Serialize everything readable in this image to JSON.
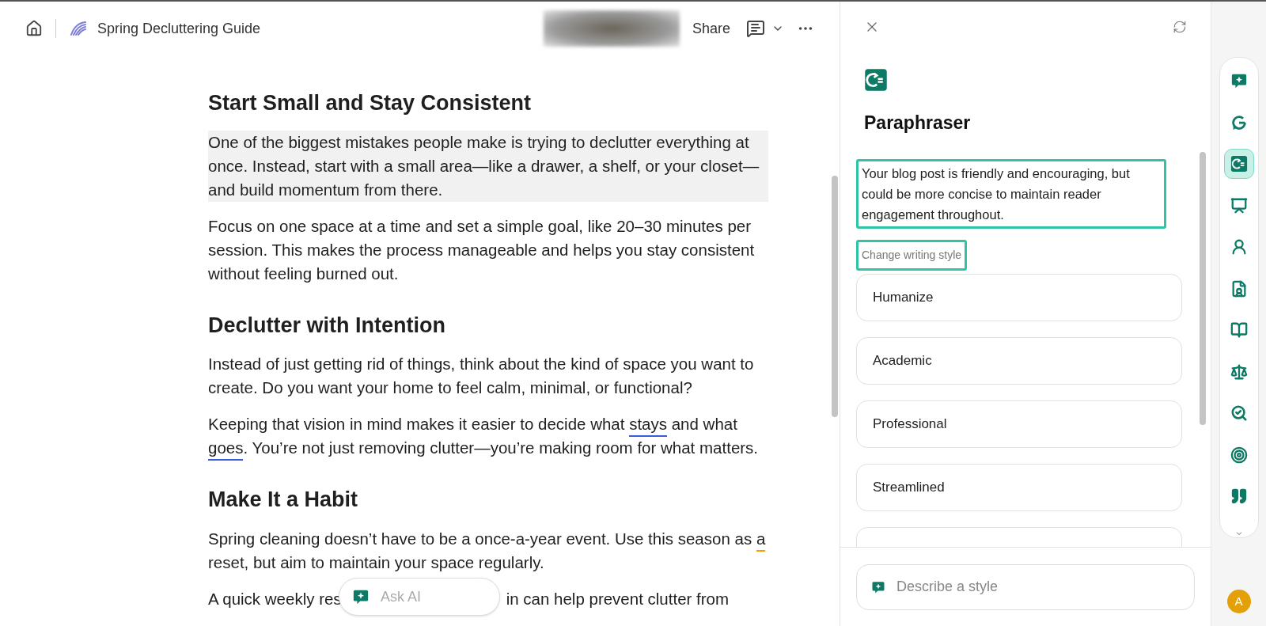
{
  "header": {
    "title": "Spring Decluttering Guide",
    "share": "Share"
  },
  "document": {
    "sections": [
      {
        "heading": "Start Small and Stay Consistent",
        "paragraphs": [
          {
            "highlighted": true,
            "segments": [
              {
                "text": "One of the biggest mistakes people make is trying to declutter everything at once. Instead, start with a small area—like a drawer, a shelf, or your closet—and build momentum from there."
              }
            ]
          },
          {
            "highlighted": false,
            "segments": [
              {
                "text": "Focus on one space at a time and set a simple goal, like 20–30 minutes per session. This makes the process manageable and helps you stay consistent without feeling burned out."
              }
            ]
          }
        ]
      },
      {
        "heading": "Declutter with Intention",
        "paragraphs": [
          {
            "highlighted": false,
            "segments": [
              {
                "text": "Instead of just getting rid of things, think about the kind of space you want to create. Do you want your home to feel calm, minimal, or functional?"
              }
            ]
          },
          {
            "highlighted": false,
            "segments": [
              {
                "text": "Keeping that vision in mind makes it easier to decide what "
              },
              {
                "text": "stays",
                "color": "#3b5bdb"
              },
              {
                "text": " and what "
              },
              {
                "text": "goes",
                "color": "#3b5bdb"
              },
              {
                "text": ". You’re not just removing clutter—you’re making room for what matters."
              }
            ]
          }
        ]
      },
      {
        "heading": "Make It a Habit",
        "paragraphs": [
          {
            "highlighted": false,
            "segments": [
              {
                "text": "Spring cleaning doesn’t have to be a once-a-year event. Use this season as "
              },
              {
                "text": "a",
                "color": "#f59f00"
              },
              {
                "text": " reset, but aim to maintain your space regularly."
              }
            ]
          }
        ]
      }
    ],
    "partial_line": {
      "before": "A quick weekly res",
      "after": "in can help prevent clutter from"
    },
    "ask_ai": {
      "placeholder": "Ask AI"
    }
  },
  "panel": {
    "title": "Paraphraser",
    "summary": "Your blog post is friendly and encouraging, but could be more concise to maintain reader engagement throughout.",
    "section_label": "Change writing style",
    "styles": [
      "Humanize",
      "Academic",
      "Professional",
      "Streamlined"
    ],
    "input": {
      "placeholder": "Describe a style"
    }
  },
  "tools": [
    {
      "selected": false
    },
    {
      "selected": false
    },
    {
      "selected": true
    },
    {
      "selected": false
    },
    {
      "selected": false
    },
    {
      "selected": false
    },
    {
      "selected": false
    },
    {
      "selected": false
    },
    {
      "selected": false
    },
    {
      "selected": false
    },
    {
      "selected": false
    }
  ],
  "avatar": "A"
}
